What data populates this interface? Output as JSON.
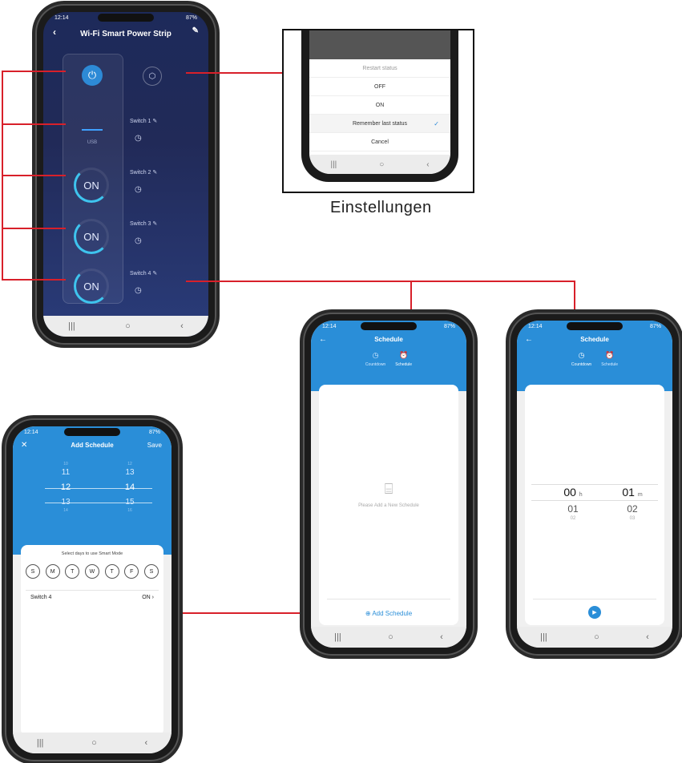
{
  "status": {
    "time": "12:14",
    "battery": "87%"
  },
  "main_phone": {
    "title": "Wi-Fi Smart Power Strip",
    "usb_label": "USB",
    "switches": [
      {
        "label": "Switch 1"
      },
      {
        "label": "Switch 2",
        "state": "ON"
      },
      {
        "label": "Switch 3",
        "state": "ON"
      },
      {
        "label": "Switch 4",
        "state": "ON"
      }
    ]
  },
  "settings_inset": {
    "title": "Restart status",
    "options": [
      "OFF",
      "ON",
      "Remember last status"
    ],
    "selected": "Remember last status",
    "cancel": "Cancel",
    "caption": "Einstellungen"
  },
  "schedule_phone": {
    "title": "Schedule",
    "tabs": [
      "Countdown",
      "Schedule"
    ],
    "empty_text": "Please Add a New Schedule",
    "add_button": "Add Schedule"
  },
  "countdown_phone": {
    "title": "Schedule",
    "tabs": [
      "Countdown",
      "Schedule"
    ],
    "hours": [
      "00",
      "01",
      "02"
    ],
    "minutes": [
      "01",
      "02",
      "03"
    ],
    "hour_unit": "h",
    "minute_unit": "m"
  },
  "add_schedule_phone": {
    "title": "Add Schedule",
    "save": "Save",
    "hours": [
      "10",
      "11",
      "12",
      "13",
      "14"
    ],
    "minutes": [
      "12",
      "13",
      "14",
      "15",
      "16"
    ],
    "days_prompt": "Select days to use Smart Mode",
    "days": [
      "S",
      "M",
      "T",
      "W",
      "T",
      "F",
      "S"
    ],
    "switch_label": "Switch 4",
    "switch_value": "ON"
  },
  "colors": {
    "accent": "#2a8ed8",
    "line": "#d8202a",
    "dark_bg": "#212a58"
  }
}
